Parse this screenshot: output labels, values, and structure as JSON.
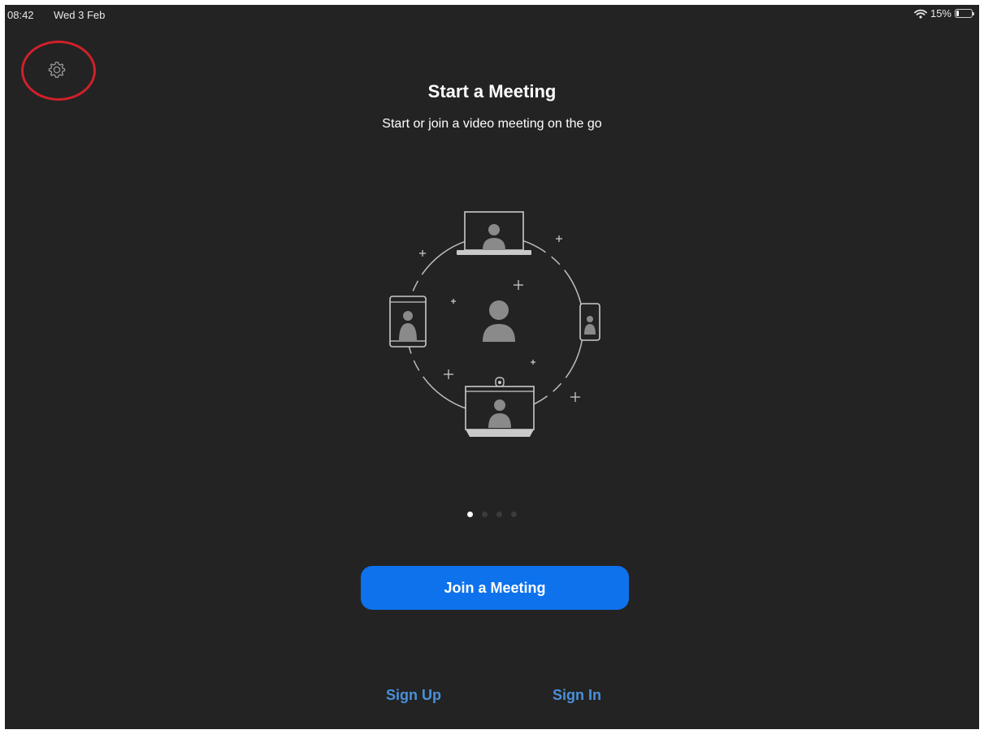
{
  "status_bar": {
    "time": "08:42",
    "date": "Wed 3 Feb",
    "battery": "15%",
    "battery_level": 0.15
  },
  "settings": {
    "icon": "gear-icon",
    "highlight_color": "#d0202a"
  },
  "onboarding": {
    "title": "Start a Meeting",
    "subtitle": "Start or join a video meeting on the go",
    "page_count": 4,
    "current_page": 1
  },
  "actions": {
    "join_label": "Join a Meeting",
    "sign_up_label": "Sign Up",
    "sign_in_label": "Sign In"
  },
  "colors": {
    "background": "#232323",
    "primary_button": "#0e72ed",
    "link": "#4a90d9"
  }
}
